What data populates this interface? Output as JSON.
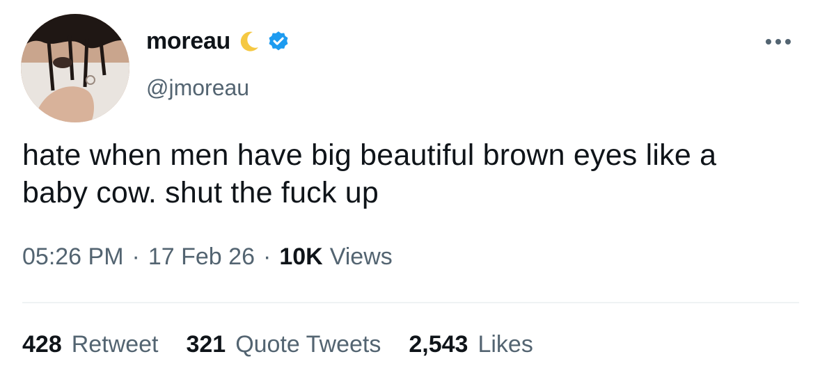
{
  "author": {
    "display_name": "moreau",
    "handle": "@jmoreau",
    "emoji_icon": "crescent-moon-icon",
    "verified_icon": "verified-badge-icon",
    "verified_color": "#1d9bf0"
  },
  "tweet": {
    "text": "hate when men have big beautiful brown eyes like a\nbaby cow. shut the fuck up",
    "time": "05:26 PM",
    "separator": "·",
    "date": "17 Feb 26",
    "views_count": "10K",
    "views_label": "Views"
  },
  "stats": [
    {
      "count": "428",
      "label": "Retweet"
    },
    {
      "count": "321",
      "label": "Quote Tweets"
    },
    {
      "count": "2,543",
      "label": "Likes"
    }
  ],
  "colors": {
    "text_primary": "#0f1419",
    "text_secondary": "#536471",
    "divider": "#eff3f4",
    "accent": "#1d9bf0"
  }
}
